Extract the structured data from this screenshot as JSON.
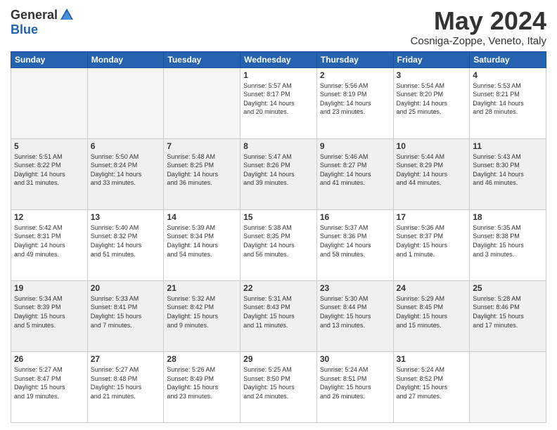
{
  "header": {
    "logo_general": "General",
    "logo_blue": "Blue",
    "month_title": "May 2024",
    "subtitle": "Cosniga-Zoppe, Veneto, Italy"
  },
  "calendar": {
    "headers": [
      "Sunday",
      "Monday",
      "Tuesday",
      "Wednesday",
      "Thursday",
      "Friday",
      "Saturday"
    ],
    "weeks": [
      [
        {
          "day": "",
          "info": "",
          "empty": true
        },
        {
          "day": "",
          "info": "",
          "empty": true
        },
        {
          "day": "",
          "info": "",
          "empty": true
        },
        {
          "day": "1",
          "info": "Sunrise: 5:57 AM\nSunset: 8:17 PM\nDaylight: 14 hours\nand 20 minutes."
        },
        {
          "day": "2",
          "info": "Sunrise: 5:56 AM\nSunset: 8:19 PM\nDaylight: 14 hours\nand 23 minutes."
        },
        {
          "day": "3",
          "info": "Sunrise: 5:54 AM\nSunset: 8:20 PM\nDaylight: 14 hours\nand 25 minutes."
        },
        {
          "day": "4",
          "info": "Sunrise: 5:53 AM\nSunset: 8:21 PM\nDaylight: 14 hours\nand 28 minutes."
        }
      ],
      [
        {
          "day": "5",
          "info": "Sunrise: 5:51 AM\nSunset: 8:22 PM\nDaylight: 14 hours\nand 31 minutes.",
          "shaded": true
        },
        {
          "day": "6",
          "info": "Sunrise: 5:50 AM\nSunset: 8:24 PM\nDaylight: 14 hours\nand 33 minutes.",
          "shaded": true
        },
        {
          "day": "7",
          "info": "Sunrise: 5:48 AM\nSunset: 8:25 PM\nDaylight: 14 hours\nand 36 minutes.",
          "shaded": true
        },
        {
          "day": "8",
          "info": "Sunrise: 5:47 AM\nSunset: 8:26 PM\nDaylight: 14 hours\nand 39 minutes.",
          "shaded": true
        },
        {
          "day": "9",
          "info": "Sunrise: 5:46 AM\nSunset: 8:27 PM\nDaylight: 14 hours\nand 41 minutes.",
          "shaded": true
        },
        {
          "day": "10",
          "info": "Sunrise: 5:44 AM\nSunset: 8:29 PM\nDaylight: 14 hours\nand 44 minutes.",
          "shaded": true
        },
        {
          "day": "11",
          "info": "Sunrise: 5:43 AM\nSunset: 8:30 PM\nDaylight: 14 hours\nand 46 minutes.",
          "shaded": true
        }
      ],
      [
        {
          "day": "12",
          "info": "Sunrise: 5:42 AM\nSunset: 8:31 PM\nDaylight: 14 hours\nand 49 minutes."
        },
        {
          "day": "13",
          "info": "Sunrise: 5:40 AM\nSunset: 8:32 PM\nDaylight: 14 hours\nand 51 minutes."
        },
        {
          "day": "14",
          "info": "Sunrise: 5:39 AM\nSunset: 8:34 PM\nDaylight: 14 hours\nand 54 minutes."
        },
        {
          "day": "15",
          "info": "Sunrise: 5:38 AM\nSunset: 8:35 PM\nDaylight: 14 hours\nand 56 minutes."
        },
        {
          "day": "16",
          "info": "Sunrise: 5:37 AM\nSunset: 8:36 PM\nDaylight: 14 hours\nand 58 minutes."
        },
        {
          "day": "17",
          "info": "Sunrise: 5:36 AM\nSunset: 8:37 PM\nDaylight: 15 hours\nand 1 minute."
        },
        {
          "day": "18",
          "info": "Sunrise: 5:35 AM\nSunset: 8:38 PM\nDaylight: 15 hours\nand 3 minutes."
        }
      ],
      [
        {
          "day": "19",
          "info": "Sunrise: 5:34 AM\nSunset: 8:39 PM\nDaylight: 15 hours\nand 5 minutes.",
          "shaded": true
        },
        {
          "day": "20",
          "info": "Sunrise: 5:33 AM\nSunset: 8:41 PM\nDaylight: 15 hours\nand 7 minutes.",
          "shaded": true
        },
        {
          "day": "21",
          "info": "Sunrise: 5:32 AM\nSunset: 8:42 PM\nDaylight: 15 hours\nand 9 minutes.",
          "shaded": true
        },
        {
          "day": "22",
          "info": "Sunrise: 5:31 AM\nSunset: 8:43 PM\nDaylight: 15 hours\nand 11 minutes.",
          "shaded": true
        },
        {
          "day": "23",
          "info": "Sunrise: 5:30 AM\nSunset: 8:44 PM\nDaylight: 15 hours\nand 13 minutes.",
          "shaded": true
        },
        {
          "day": "24",
          "info": "Sunrise: 5:29 AM\nSunset: 8:45 PM\nDaylight: 15 hours\nand 15 minutes.",
          "shaded": true
        },
        {
          "day": "25",
          "info": "Sunrise: 5:28 AM\nSunset: 8:46 PM\nDaylight: 15 hours\nand 17 minutes.",
          "shaded": true
        }
      ],
      [
        {
          "day": "26",
          "info": "Sunrise: 5:27 AM\nSunset: 8:47 PM\nDaylight: 15 hours\nand 19 minutes."
        },
        {
          "day": "27",
          "info": "Sunrise: 5:27 AM\nSunset: 8:48 PM\nDaylight: 15 hours\nand 21 minutes."
        },
        {
          "day": "28",
          "info": "Sunrise: 5:26 AM\nSunset: 8:49 PM\nDaylight: 15 hours\nand 23 minutes."
        },
        {
          "day": "29",
          "info": "Sunrise: 5:25 AM\nSunset: 8:50 PM\nDaylight: 15 hours\nand 24 minutes."
        },
        {
          "day": "30",
          "info": "Sunrise: 5:24 AM\nSunset: 8:51 PM\nDaylight: 15 hours\nand 26 minutes."
        },
        {
          "day": "31",
          "info": "Sunrise: 5:24 AM\nSunset: 8:52 PM\nDaylight: 15 hours\nand 27 minutes."
        },
        {
          "day": "",
          "info": "",
          "empty": true
        }
      ]
    ]
  }
}
